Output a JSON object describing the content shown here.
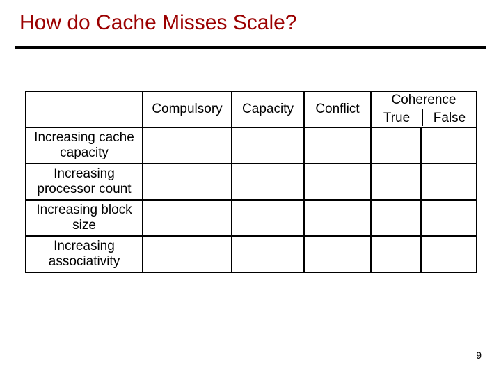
{
  "title": "How do Cache Misses Scale?",
  "columns": {
    "compulsory": "Compulsory",
    "capacity": "Capacity",
    "conflict": "Conflict",
    "coherence": "Coherence",
    "coherence_true": "True",
    "coherence_false": "False"
  },
  "rows": [
    {
      "label_line1": "Increasing cache",
      "label_line2": "capacity"
    },
    {
      "label_line1": "Increasing",
      "label_line2": "processor count"
    },
    {
      "label_line1": "Increasing block",
      "label_line2": "size"
    },
    {
      "label_line1": "Increasing",
      "label_line2": "associativity"
    }
  ],
  "page_number": "9",
  "chart_data": {
    "type": "table",
    "title": "How do Cache Misses Scale?",
    "columns": [
      "",
      "Compulsory",
      "Capacity",
      "Conflict",
      "Coherence True",
      "Coherence False"
    ],
    "rows": [
      [
        "Increasing cache capacity",
        "",
        "",
        "",
        "",
        ""
      ],
      [
        "Increasing processor count",
        "",
        "",
        "",
        "",
        ""
      ],
      [
        "Increasing block size",
        "",
        "",
        "",
        "",
        ""
      ],
      [
        "Increasing associativity",
        "",
        "",
        "",
        "",
        ""
      ]
    ]
  }
}
